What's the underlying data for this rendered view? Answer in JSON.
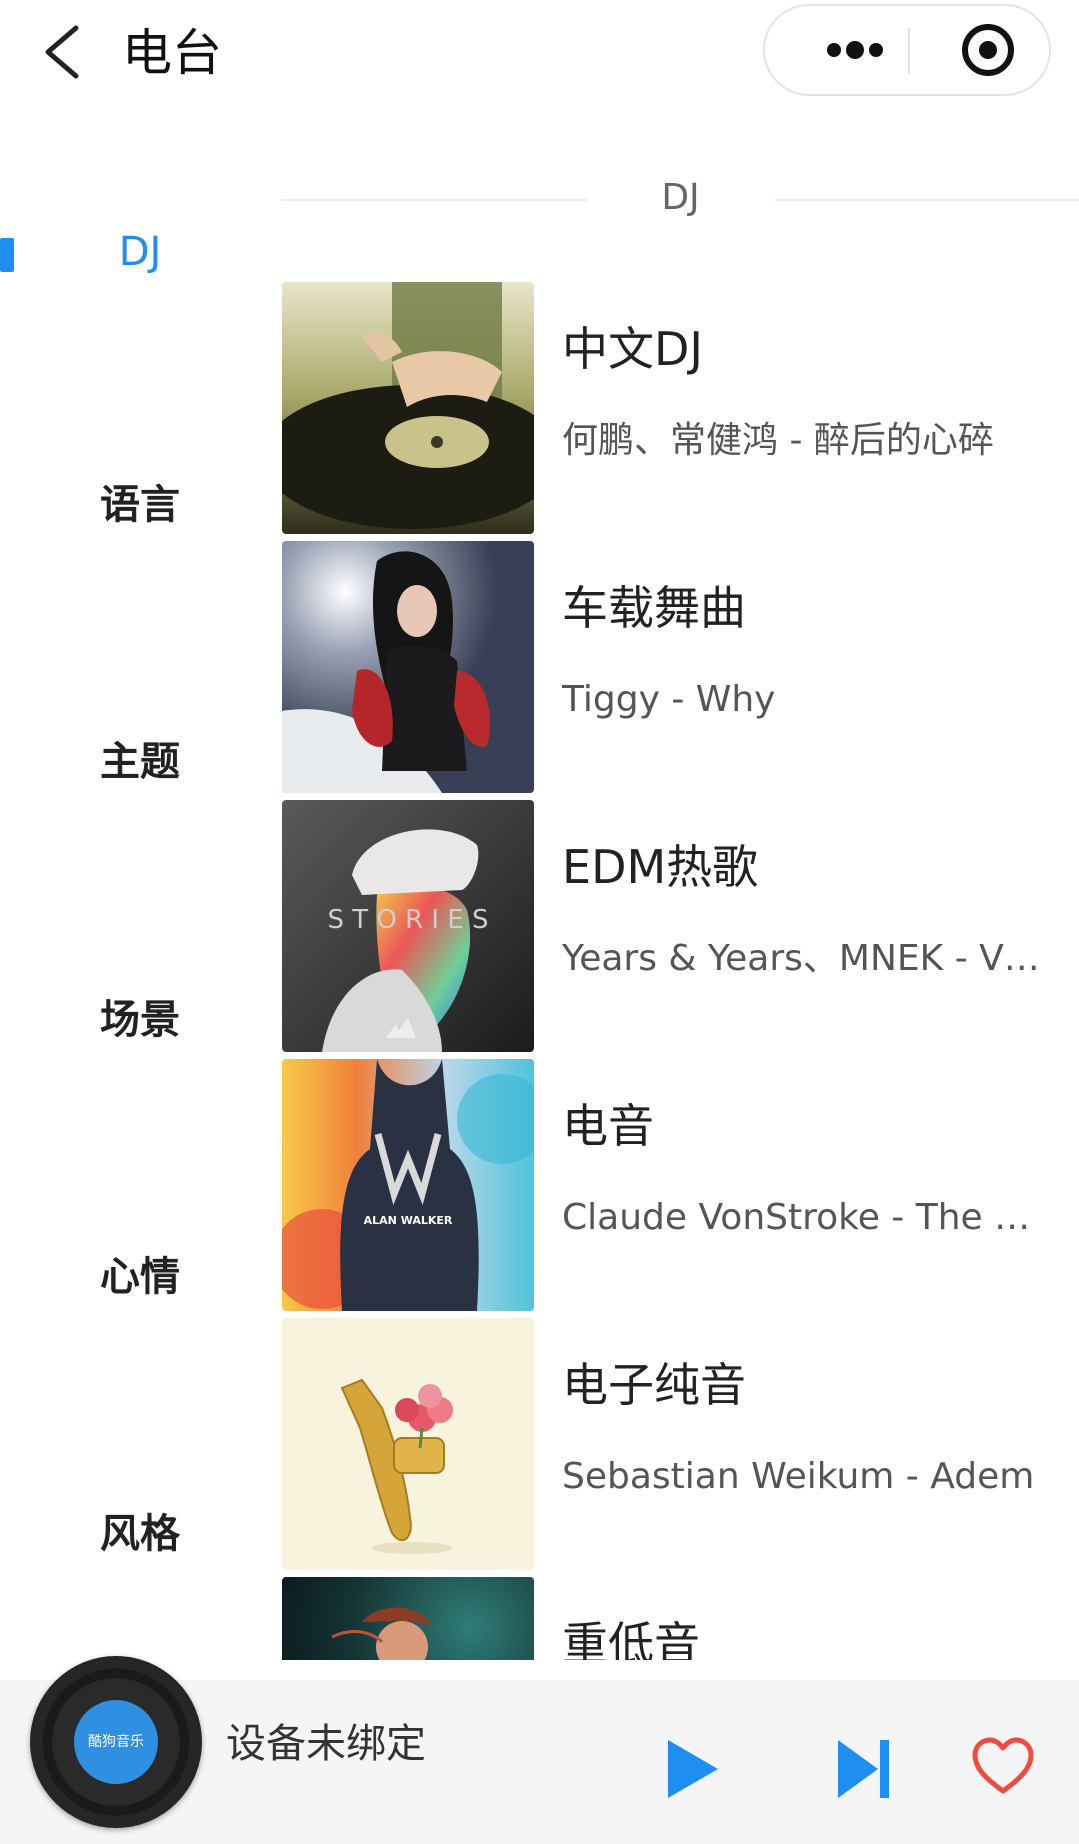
{
  "header": {
    "title": "电台",
    "back_icon": "chevron-left-icon",
    "more_icon": "more-dots-icon",
    "target_icon": "record-target-icon"
  },
  "sidebar": {
    "items": [
      {
        "label": "DJ",
        "active": true
      },
      {
        "label": "语言"
      },
      {
        "label": "主题"
      },
      {
        "label": "场景"
      },
      {
        "label": "心情"
      },
      {
        "label": "风格"
      }
    ],
    "accent_color": "#1e8ef2"
  },
  "section": {
    "title": "DJ"
  },
  "stations": [
    {
      "title": "中文DJ",
      "subtitle": "何鹏、常健鸿 - 醉后的心碎"
    },
    {
      "title": "车载舞曲",
      "subtitle": "Tiggy - Why"
    },
    {
      "title": "EDM热歌",
      "subtitle": "Years & Years、MNEK - V…",
      "cover_text": "S T O R I E S"
    },
    {
      "title": "电音",
      "subtitle": "Claude VonStroke - The …",
      "cover_text": "ALAN WALKER"
    },
    {
      "title": "电子纯音",
      "subtitle": "Sebastian Weikum - Adem"
    },
    {
      "title": "重低音",
      "subtitle": ""
    }
  ],
  "player": {
    "status_text": "设备未绑定",
    "disc_label": "酷狗音乐",
    "play_icon": "play-icon",
    "next_icon": "skip-next-icon",
    "favorite_icon": "heart-icon",
    "play_color": "#1e8ef2",
    "favorite_color": "#ef4b3f"
  }
}
